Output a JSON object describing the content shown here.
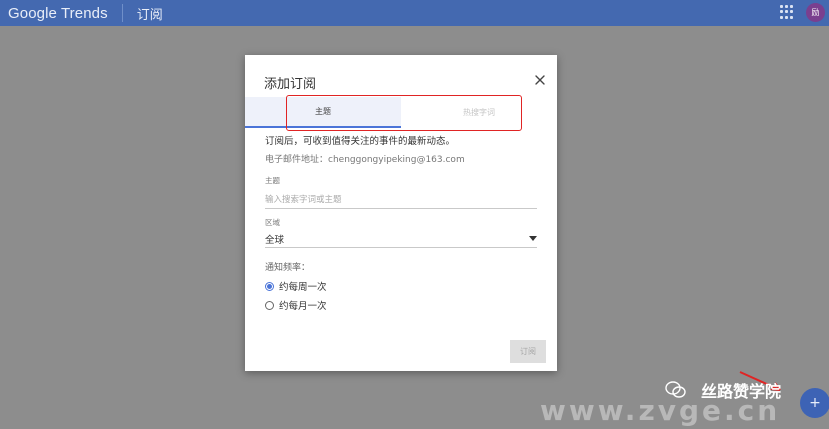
{
  "appbar": {
    "logo_text": "Google Trends",
    "section_title": "订阅",
    "avatar_initial": "励"
  },
  "dialog": {
    "title": "添加订阅",
    "tabs": [
      {
        "label": "主题",
        "active": true
      },
      {
        "label": "热搜字词",
        "active": false
      }
    ],
    "description": "订阅后，可收到值得关注的事件的最新动态。",
    "email_line": "电子邮件地址：chenggongyipeking@163.com",
    "topic": {
      "label": "主题",
      "placeholder": "输入搜索字词或主题",
      "value": ""
    },
    "region": {
      "label": "区域",
      "value": "全球"
    },
    "frequency": {
      "label": "通知频率：",
      "options": [
        {
          "label": "约每周一次",
          "checked": true
        },
        {
          "label": "约每月一次",
          "checked": false
        }
      ]
    },
    "subscribe_label": "订阅"
  },
  "watermark": {
    "brand": "丝路赞学院",
    "url": "www.zvge.cn"
  },
  "colors": {
    "appbar": "#4469b0",
    "accent": "#4a74d8",
    "annotation": "#e02424"
  }
}
